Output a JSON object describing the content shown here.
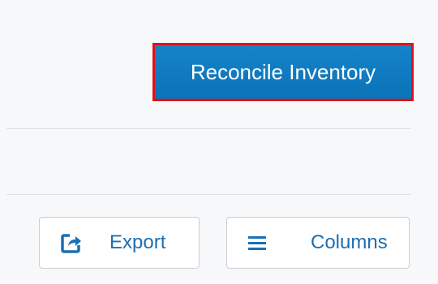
{
  "header": {
    "primary_button_label": "Reconcile Inventory"
  },
  "toolbar": {
    "export_label": "Export",
    "columns_label": "Columns"
  },
  "icons": {
    "export": "export-share-icon",
    "columns": "hamburger-menu-icon"
  },
  "colors": {
    "primary_button_bg": "#0e78be",
    "highlight_border": "#e2101c",
    "toolbar_text": "#1b6fb3",
    "background": "#f7f8f9"
  }
}
